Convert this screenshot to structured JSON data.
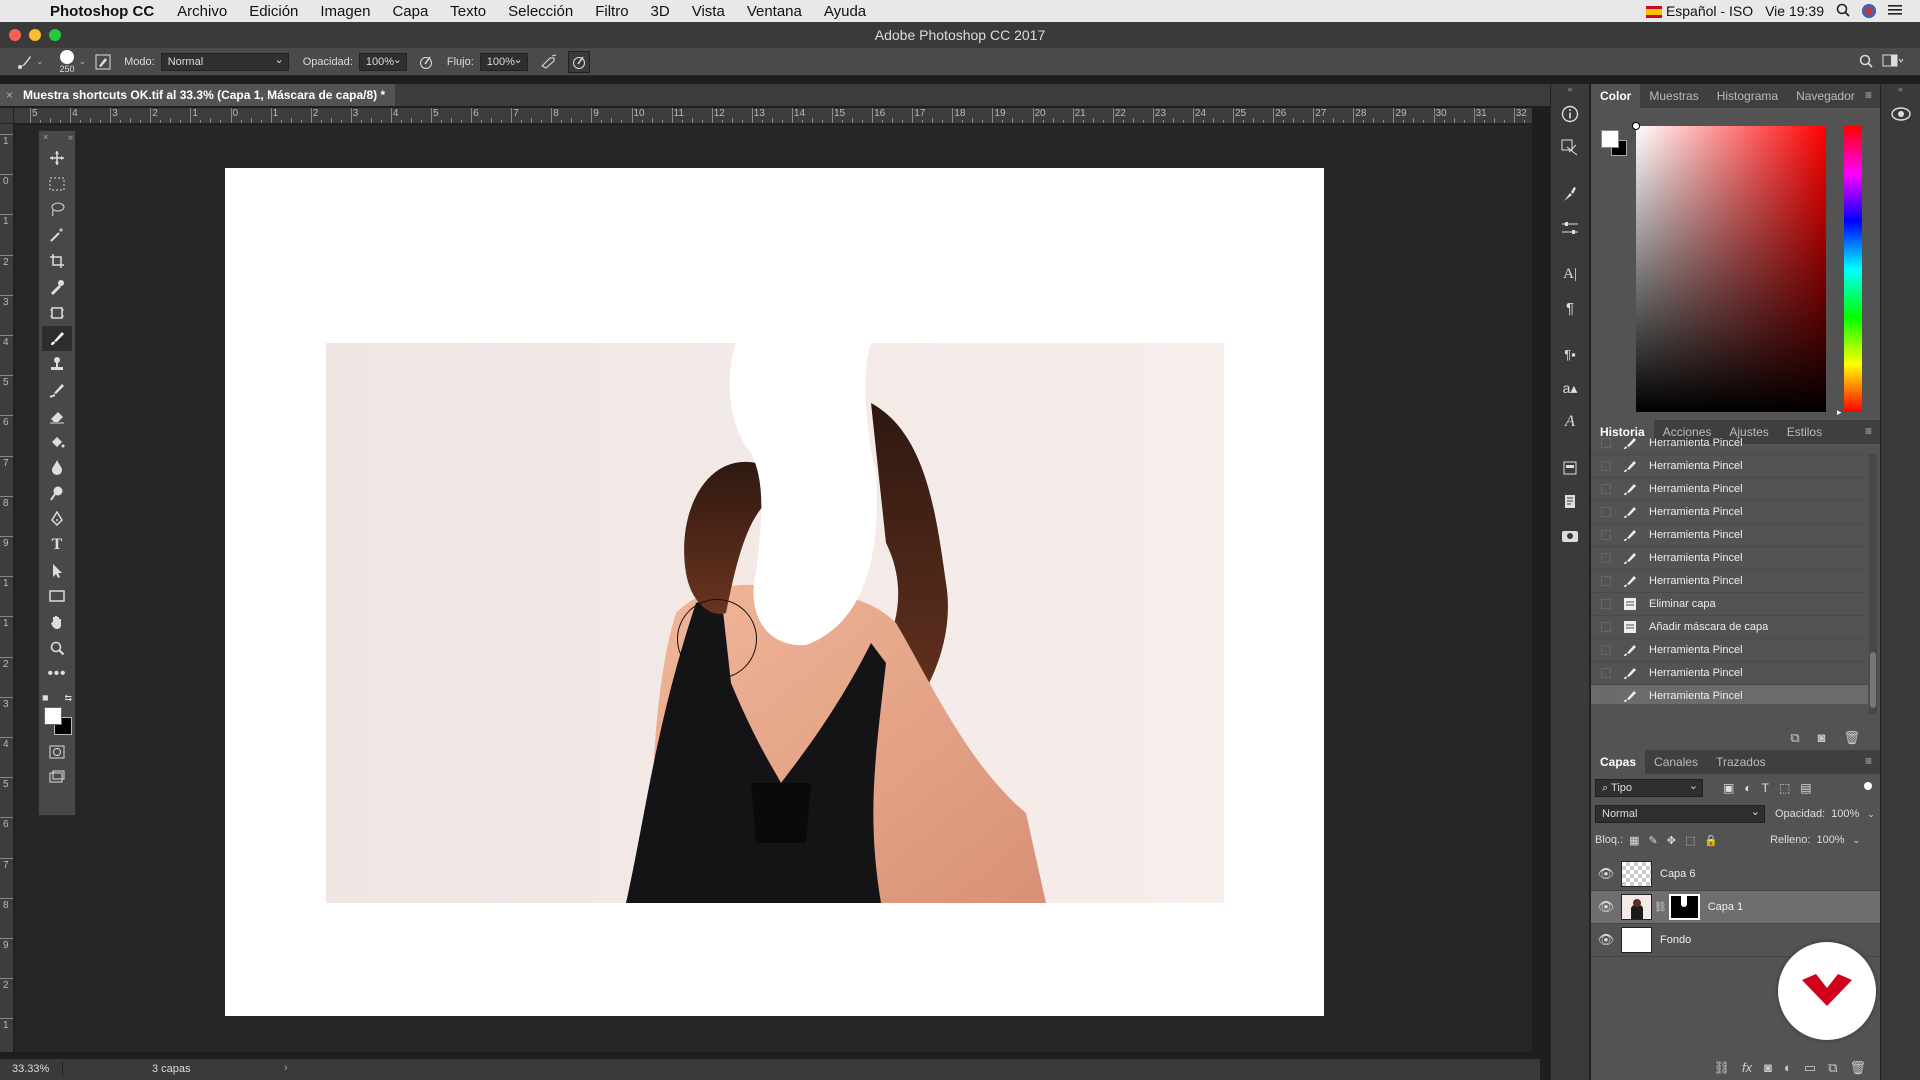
{
  "menubar": {
    "app": "Photoshop CC",
    "items": [
      "Archivo",
      "Edición",
      "Imagen",
      "Capa",
      "Texto",
      "Selección",
      "Filtro",
      "3D",
      "Vista",
      "Ventana",
      "Ayuda"
    ],
    "input_source": "Español - ISO",
    "clock": "Vie 19:39"
  },
  "window": {
    "title": "Adobe Photoshop CC 2017"
  },
  "options": {
    "brush_size": "250",
    "mode_label": "Modo:",
    "mode_value": "Normal",
    "opacity_label": "Opacidad:",
    "opacity_value": "100%",
    "flow_label": "Flujo:",
    "flow_value": "100%"
  },
  "document": {
    "tab_title": "Muestra shortcuts OK.tif al 33.3% (Capa 1, Máscara de capa/8) *",
    "zoom": "33.33%",
    "layer_count": "3 capas"
  },
  "rulers": {
    "h_labels": [
      "5",
      "4",
      "3",
      "2",
      "1",
      "0",
      "1",
      "2",
      "3",
      "4",
      "5",
      "6",
      "7",
      "8",
      "9",
      "10",
      "11",
      "12",
      "13",
      "14",
      "15",
      "16",
      "17",
      "18",
      "19",
      "20",
      "21",
      "22",
      "23",
      "24",
      "25",
      "26",
      "27",
      "28",
      "29",
      "30",
      "31",
      "32",
      "3"
    ],
    "v_labels": [
      "1",
      "0",
      "1",
      "2",
      "3",
      "4",
      "5",
      "6",
      "7",
      "8",
      "9",
      "1",
      "1",
      "2",
      "3",
      "4",
      "5",
      "6",
      "7",
      "8",
      "9",
      "2",
      "1",
      "2"
    ]
  },
  "color_panel": {
    "tabs": [
      "Color",
      "Muestras",
      "Histograma",
      "Navegador"
    ],
    "active_tab": "Color",
    "foreground": "#ffffff",
    "background": "#000000"
  },
  "history_panel": {
    "tabs": [
      "Historia",
      "Acciones",
      "Ajustes",
      "Estilos"
    ],
    "active_tab": "Historia",
    "items": [
      {
        "label": "Herramienta Pincel",
        "icon": "brush-icon"
      },
      {
        "label": "Herramienta Pincel",
        "icon": "brush-icon"
      },
      {
        "label": "Herramienta Pincel",
        "icon": "brush-icon"
      },
      {
        "label": "Herramienta Pincel",
        "icon": "brush-icon"
      },
      {
        "label": "Herramienta Pincel",
        "icon": "brush-icon"
      },
      {
        "label": "Herramienta Pincel",
        "icon": "brush-icon"
      },
      {
        "label": "Herramienta Pincel",
        "icon": "brush-icon"
      },
      {
        "label": "Eliminar capa",
        "icon": "document-icon"
      },
      {
        "label": "Añadir máscara de capa",
        "icon": "document-icon"
      },
      {
        "label": "Herramienta Pincel",
        "icon": "brush-icon"
      },
      {
        "label": "Herramienta Pincel",
        "icon": "brush-icon"
      },
      {
        "label": "Herramienta Pincel",
        "icon": "brush-icon"
      }
    ],
    "selected_index": 11
  },
  "layers_panel": {
    "tabs": [
      "Capas",
      "Canales",
      "Trazados"
    ],
    "active_tab": "Capas",
    "filter_label": "Tipo",
    "blend_mode": "Normal",
    "opacity_label": "Opacidad:",
    "opacity_value": "100%",
    "lock_label": "Bloq.:",
    "fill_label": "Relleno:",
    "fill_value": "100%",
    "layers": [
      {
        "name": "Capa 6",
        "visible": true,
        "thumb": "transparent"
      },
      {
        "name": "Capa 1",
        "visible": true,
        "thumb": "photo",
        "has_mask": true
      },
      {
        "name": "Fondo",
        "visible": true,
        "thumb": "white",
        "locked": true
      }
    ],
    "selected_layer": "Capa 1"
  },
  "toolbox": {
    "tools": [
      "move-tool",
      "marquee-tool",
      "lasso-tool",
      "magic-wand-tool",
      "crop-tool",
      "eyedropper-tool",
      "frame-tool",
      "brush-tool",
      "stamp-tool",
      "history-brush-tool",
      "eraser-tool",
      "paint-bucket-tool",
      "blur-tool",
      "dodge-tool",
      "pen-tool",
      "type-tool",
      "path-select-tool",
      "rectangle-tool",
      "hand-tool",
      "zoom-tool",
      "more-tools"
    ],
    "active": "brush-tool"
  },
  "colors": {
    "accent_logo": "#d0021b",
    "panel_bg": "#535353",
    "canvas_bg": "#262626"
  }
}
